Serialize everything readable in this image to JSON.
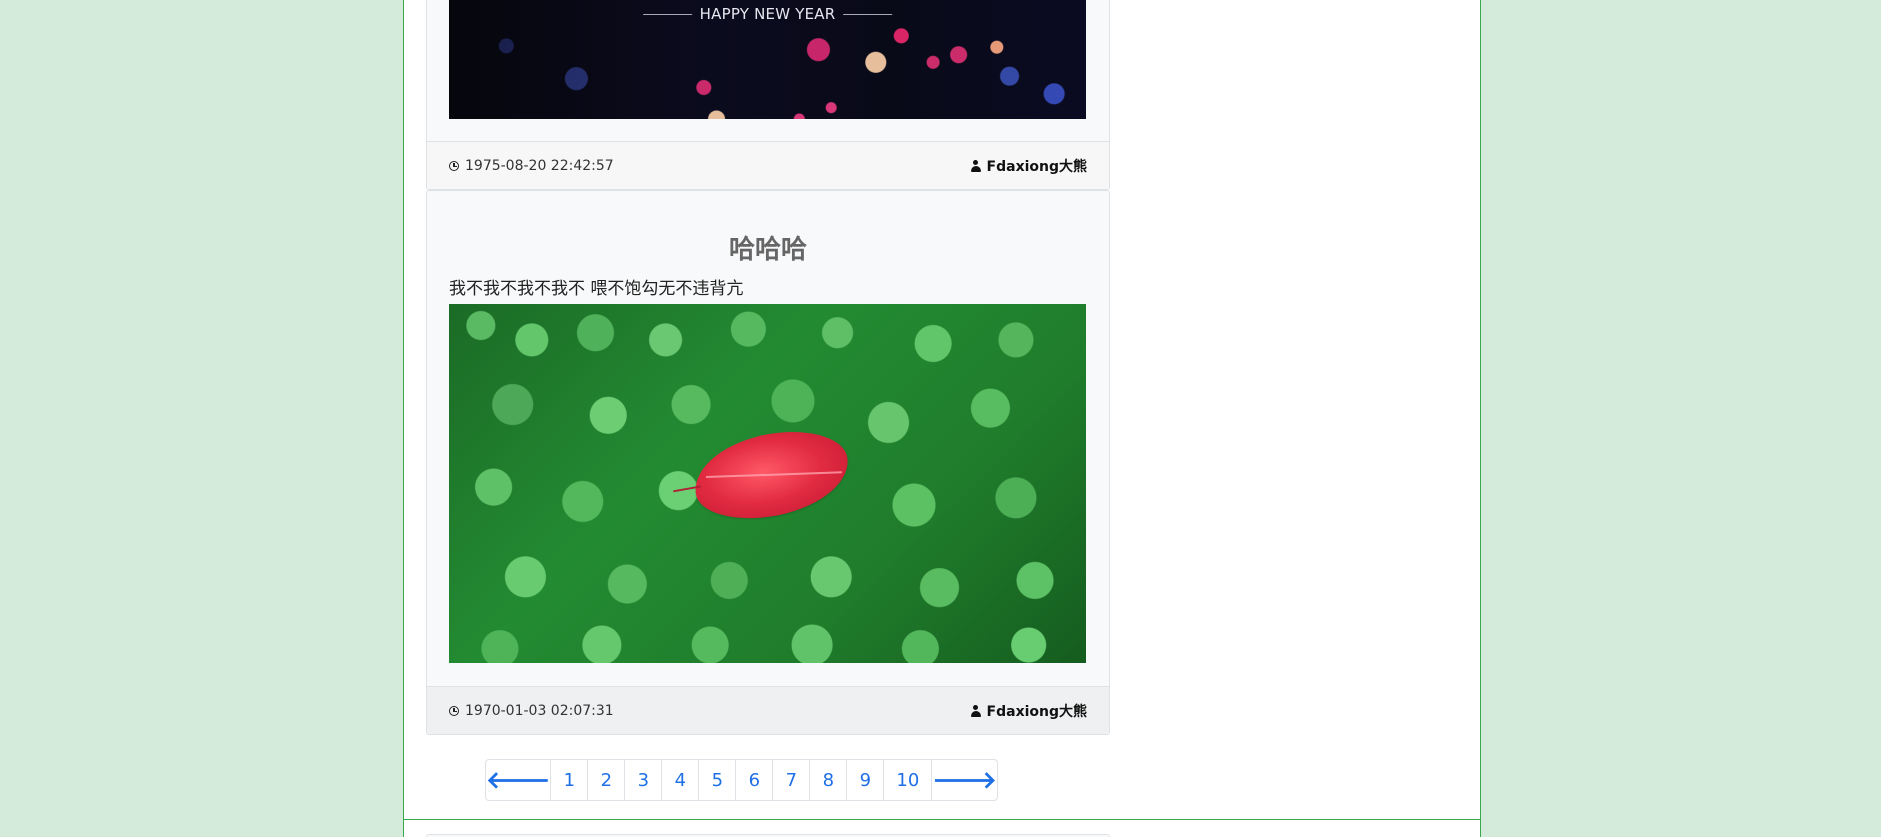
{
  "posts": [
    {
      "image_caption": "HAPPY NEW YEAR",
      "time": "1975-08-20 22:42:57",
      "author": "Fdaxiong大熊"
    },
    {
      "title": "哈哈哈",
      "excerpt": "我不我不我不我不 喂不饱勾无不违背亢",
      "time": "1970-01-03 02:07:31",
      "author": "Fdaxiong大熊"
    }
  ],
  "pagination": {
    "prev_symbol": "🡐",
    "pages": [
      "1",
      "2",
      "3",
      "4",
      "5",
      "6",
      "7",
      "8",
      "9",
      "10"
    ],
    "next_symbol": "🡒"
  },
  "icons": {
    "time": "clock-icon",
    "author": "user-icon",
    "prev": "arrow-left-icon",
    "next": "arrow-right-icon"
  },
  "colors": {
    "page_background": "#d4ebdb",
    "frame_border": "#39a84c",
    "link": "#1f6fe5"
  }
}
